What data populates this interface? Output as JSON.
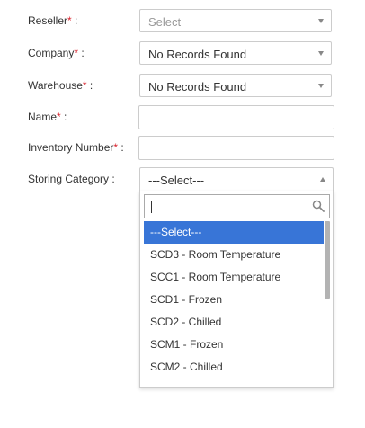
{
  "form": {
    "reseller": {
      "label": "Reseller",
      "req": "*",
      "suffix": " :",
      "value": "Select"
    },
    "company": {
      "label": "Company",
      "req": "*",
      "suffix": " :",
      "value": "No Records Found"
    },
    "warehouse": {
      "label": "Warehouse",
      "req": "*",
      "suffix": " :",
      "value": "No Records Found"
    },
    "name": {
      "label": "Name",
      "req": "*",
      "suffix": " :",
      "value": ""
    },
    "inventory_number": {
      "label": "Inventory Number",
      "req": "*",
      "suffix": " :",
      "value": ""
    },
    "storing_category": {
      "label": "Storing Category :",
      "value": "---Select---",
      "search_value": "",
      "options": [
        "---Select---",
        "SCD3 - Room Temperature",
        "SCC1 - Room Temperature",
        "SCD1 - Frozen",
        "SCD2 - Chilled",
        "SCM1 - Frozen",
        "SCM2 - Chilled"
      ],
      "highlighted_index": 0
    }
  },
  "colors": {
    "required": "#d9232d",
    "highlight": "#3875d7",
    "border": "#cccccc"
  },
  "icons": {
    "select_caret": "chevron-down-icon",
    "open_caret": "chevron-up-icon",
    "search": "search-icon"
  }
}
